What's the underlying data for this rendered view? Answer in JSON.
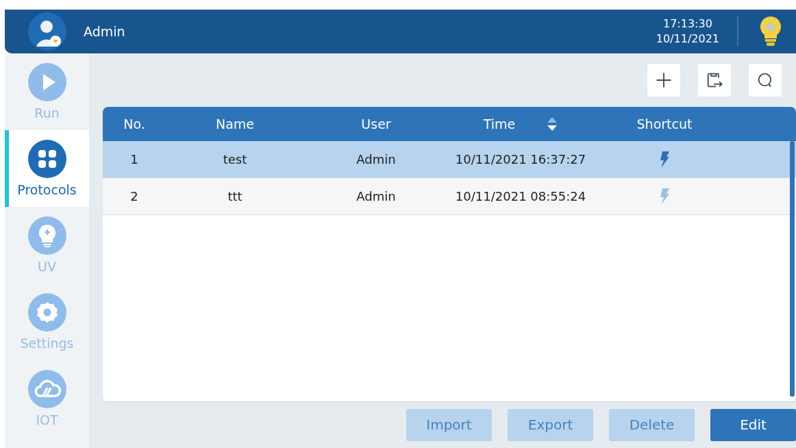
{
  "header": {
    "user": "Admin",
    "time": "17:13:30",
    "date": "10/11/2021"
  },
  "sidebar": {
    "items": [
      {
        "label": "Run",
        "kind": "run",
        "selected": false
      },
      {
        "label": "Protocols",
        "kind": "protocols",
        "selected": true
      },
      {
        "label": "UV",
        "kind": "uv",
        "selected": false
      },
      {
        "label": "Settings",
        "kind": "settings",
        "selected": false
      },
      {
        "label": "IOT",
        "kind": "iot",
        "selected": false
      }
    ]
  },
  "toolbar": [
    {
      "kind": "add"
    },
    {
      "kind": "export"
    },
    {
      "kind": "search"
    }
  ],
  "table": {
    "columns": [
      {
        "label": "No.",
        "sortable": false
      },
      {
        "label": "Name",
        "sortable": false
      },
      {
        "label": "User",
        "sortable": false
      },
      {
        "label": "Time",
        "sortable": true
      },
      {
        "label": "Shortcut",
        "sortable": false
      }
    ],
    "rows": [
      {
        "no": "1",
        "name": "test",
        "user": "Admin",
        "time": "10/11/2021 16:37:27",
        "shortcut": true,
        "selected": true
      },
      {
        "no": "2",
        "name": "ttt",
        "user": "Admin",
        "time": "10/11/2021 08:55:24",
        "shortcut": false,
        "selected": false
      }
    ]
  },
  "buttons": [
    {
      "label": "Import",
      "disabled": true
    },
    {
      "label": "Export",
      "disabled": true
    },
    {
      "label": "Delete",
      "disabled": true
    },
    {
      "label": "Edit",
      "disabled": false
    }
  ]
}
